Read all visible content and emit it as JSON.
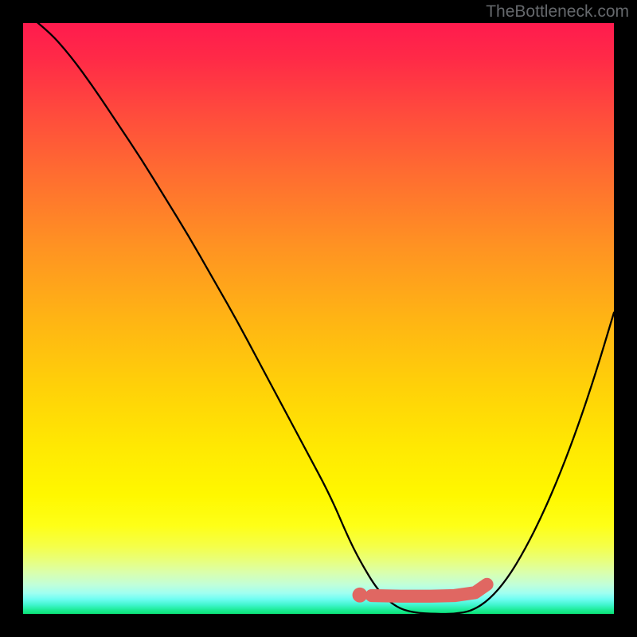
{
  "watermark": "TheBottleneck.com",
  "colors": {
    "curve": "#000000",
    "marker_fill": "#e06762",
    "marker_stroke": "#e06762",
    "bg_black": "#000000"
  },
  "chart_data": {
    "type": "line",
    "title": "",
    "xlabel": "",
    "ylabel": "",
    "xlim": [
      0,
      100
    ],
    "ylim": [
      0,
      100
    ],
    "grid": false,
    "legend": false,
    "series": [
      {
        "name": "bottleneck-curve",
        "x": [
          0,
          4,
          8,
          12,
          16,
          20,
          24,
          28,
          32,
          36,
          40,
          44,
          48,
          52,
          55,
          57,
          60,
          63,
          66,
          70,
          73,
          76,
          79,
          82,
          85,
          88,
          91,
          94,
          97,
          100
        ],
        "y": [
          102,
          99,
          94.5,
          89,
          83,
          77,
          70.5,
          64,
          57,
          50,
          42.5,
          35,
          27.5,
          20,
          13,
          9,
          4,
          1.2,
          0.2,
          0,
          0,
          0.5,
          2.5,
          6,
          11,
          17,
          24,
          32,
          41,
          51
        ]
      }
    ],
    "markers": [
      {
        "name": "sweet-spot-start-dot",
        "type": "circle",
        "x": 57,
        "y": 3.2,
        "r": 1.2
      },
      {
        "name": "sweet-spot-band",
        "type": "thickline",
        "points": [
          {
            "x": 59,
            "y": 3.1
          },
          {
            "x": 64,
            "y": 3.0
          },
          {
            "x": 69,
            "y": 3.0
          },
          {
            "x": 73,
            "y": 3.1
          },
          {
            "x": 76.5,
            "y": 3.6
          },
          {
            "x": 78.5,
            "y": 5.0
          }
        ],
        "width": 2.2
      }
    ]
  }
}
